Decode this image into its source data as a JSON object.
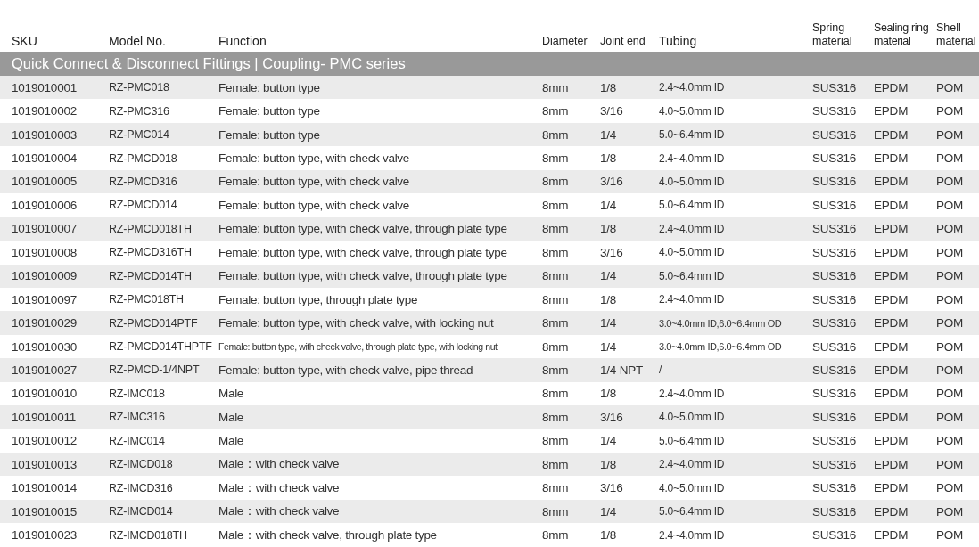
{
  "table": {
    "columns": [
      "SKU",
      "Model No.",
      "Function",
      "Diameter",
      "Joint end",
      "Tubing",
      "Spring material",
      "Sealing ring material",
      "Shell material"
    ],
    "group": "Quick Connect & Disconnect Fittings | Coupling- PMC series",
    "rows": [
      [
        "1019010001",
        "RZ-PMC018",
        "Female: button type",
        "8mm",
        "1/8",
        "2.4~4.0mm ID",
        "SUS316",
        "EPDM",
        "POM"
      ],
      [
        "1019010002",
        "RZ-PMC316",
        "Female: button type",
        "8mm",
        "3/16",
        "4.0~5.0mm ID",
        "SUS316",
        "EPDM",
        "POM"
      ],
      [
        "1019010003",
        "RZ-PMC014",
        "Female: button type",
        "8mm",
        "1/4",
        "5.0~6.4mm ID",
        "SUS316",
        "EPDM",
        "POM"
      ],
      [
        "1019010004",
        "RZ-PMCD018",
        "Female: button type, with check valve",
        "8mm",
        "1/8",
        "2.4~4.0mm ID",
        "SUS316",
        "EPDM",
        "POM"
      ],
      [
        "1019010005",
        "RZ-PMCD316",
        "Female: button type, with check valve",
        "8mm",
        "3/16",
        "4.0~5.0mm ID",
        "SUS316",
        "EPDM",
        "POM"
      ],
      [
        "1019010006",
        "RZ-PMCD014",
        "Female: button type, with check valve",
        "8mm",
        "1/4",
        "5.0~6.4mm ID",
        "SUS316",
        "EPDM",
        "POM"
      ],
      [
        "1019010007",
        "RZ-PMCD018TH",
        "Female: button type, with check valve, through plate type",
        "8mm",
        "1/8",
        "2.4~4.0mm ID",
        "SUS316",
        "EPDM",
        "POM"
      ],
      [
        "1019010008",
        "RZ-PMCD316TH",
        "Female: button type, with check valve, through plate type",
        "8mm",
        "3/16",
        "4.0~5.0mm ID",
        "SUS316",
        "EPDM",
        "POM"
      ],
      [
        "1019010009",
        "RZ-PMCD014TH",
        "Female: button type, with check valve, through plate type",
        "8mm",
        "1/4",
        "5.0~6.4mm ID",
        "SUS316",
        "EPDM",
        "POM"
      ],
      [
        "1019010097",
        "RZ-PMC018TH",
        "Female: button type, through plate type",
        "8mm",
        "1/8",
        "2.4~4.0mm ID",
        "SUS316",
        "EPDM",
        "POM"
      ],
      [
        "1019010029",
        "RZ-PMCD014PTF",
        "Female: button type, with check valve, with locking nut",
        "8mm",
        "1/4",
        "3.0~4.0mm ID,6.0~6.4mm OD",
        "SUS316",
        "EPDM",
        "POM"
      ],
      [
        "1019010030",
        "RZ-PMCD014THPTF",
        "Female: button type, with check valve, through plate type, with locking nut",
        "8mm",
        "1/4",
        "3.0~4.0mm ID,6.0~6.4mm OD",
        "SUS316",
        "EPDM",
        "POM"
      ],
      [
        "1019010027",
        "RZ-PMCD-1/4NPT",
        "Female: button type, with check valve, pipe thread",
        "8mm",
        "1/4 NPT",
        "/",
        "SUS316",
        "EPDM",
        "POM"
      ],
      [
        "1019010010",
        "RZ-IMC018",
        "Male",
        "8mm",
        "1/8",
        "2.4~4.0mm ID",
        "SUS316",
        "EPDM",
        "POM"
      ],
      [
        "1019010011",
        "RZ-IMC316",
        "Male",
        "8mm",
        "3/16",
        "4.0~5.0mm ID",
        "SUS316",
        "EPDM",
        "POM"
      ],
      [
        "1019010012",
        "RZ-IMC014",
        "Male",
        "8mm",
        "1/4",
        "5.0~6.4mm ID",
        "SUS316",
        "EPDM",
        "POM"
      ],
      [
        "1019010013",
        "RZ-IMCD018",
        "Male：with check valve",
        "8mm",
        "1/8",
        "2.4~4.0mm ID",
        "SUS316",
        "EPDM",
        "POM"
      ],
      [
        "1019010014",
        "RZ-IMCD316",
        "Male：with check valve",
        "8mm",
        "3/16",
        "4.0~5.0mm ID",
        "SUS316",
        "EPDM",
        "POM"
      ],
      [
        "1019010015",
        "RZ-IMCD014",
        "Male：with check valve",
        "8mm",
        "1/4",
        "5.0~6.4mm ID",
        "SUS316",
        "EPDM",
        "POM"
      ],
      [
        "1019010023",
        "RZ-IMCD018TH",
        "Male：with check valve, through plate type",
        "8mm",
        "1/8",
        "2.4~4.0mm ID",
        "SUS316",
        "EPDM",
        "POM"
      ]
    ]
  }
}
